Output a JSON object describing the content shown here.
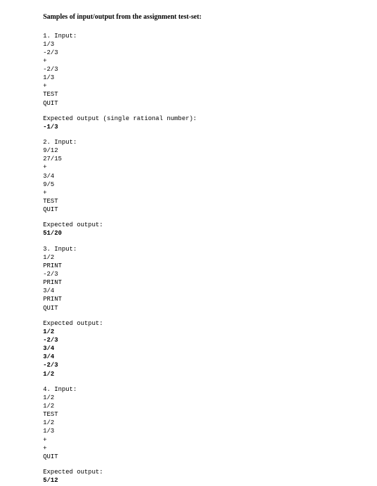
{
  "title": "Samples of input/output from the assignment test-set:",
  "samples": [
    {
      "header": "1. Input:",
      "input_lines": [
        "1/3",
        "-2/3",
        "+",
        "-2/3",
        "1/3",
        "+",
        "TEST",
        "QUIT"
      ],
      "expected_label": "Expected output (single rational number):",
      "output_lines": [
        "-1/3"
      ]
    },
    {
      "header": "2. Input:",
      "input_lines": [
        "9/12",
        "27/15",
        "+",
        "3/4",
        "9/5",
        "+",
        "TEST",
        "QUIT"
      ],
      "expected_label": "Expected output:",
      "output_lines": [
        "51/20"
      ]
    },
    {
      "header": "3. Input:",
      "input_lines": [
        "1/2",
        "PRINT",
        "-2/3",
        "PRINT",
        "3/4",
        "PRINT",
        "QUIT"
      ],
      "expected_label": "Expected output:",
      "output_lines": [
        "1/2",
        "-2/3",
        "3/4",
        "3/4",
        "-2/3",
        "1/2"
      ]
    },
    {
      "header": "4. Input:",
      "input_lines": [
        "1/2",
        "1/2",
        "TEST",
        "1/2",
        "1/3",
        "+",
        "+",
        "QUIT"
      ],
      "expected_label": "Expected output:",
      "output_lines": [
        "5/12"
      ]
    }
  ]
}
